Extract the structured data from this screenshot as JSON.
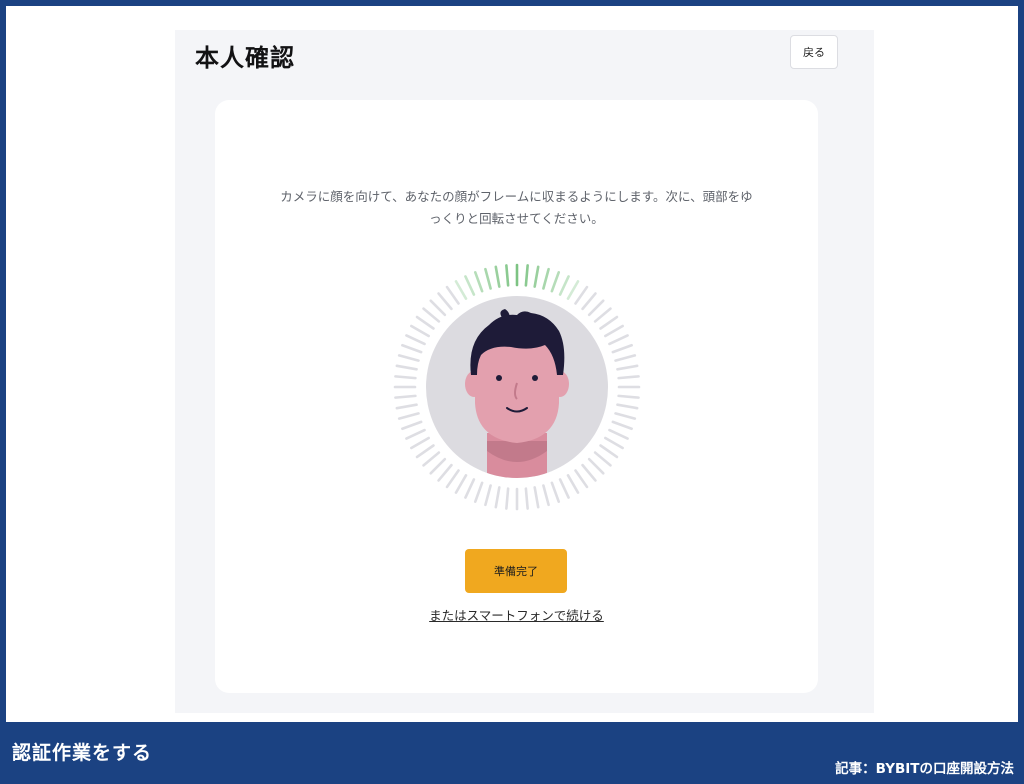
{
  "page": {
    "title": "本人確認",
    "back_label": "戻る"
  },
  "card": {
    "instruction": "カメラに顔を向けて、あなたの顔がフレームに収まるようにします。次に、頭部をゆっくりと回転させてください。",
    "ready_label": "準備完了",
    "smartphone_link": "またはスマートフォンで続ける"
  },
  "scanner": {
    "progress_color": "#7dc383",
    "idle_color": "#dedee3",
    "avatar_bg": "#dcdbe0",
    "skin_color": "#e3a0ae",
    "hair_color": "#1e1b38"
  },
  "caption": {
    "left": "認証作業をする",
    "right": "記事：BYBITの口座開設方法"
  },
  "colors": {
    "frame": "#1b4282",
    "accent": "#f0a81f"
  }
}
